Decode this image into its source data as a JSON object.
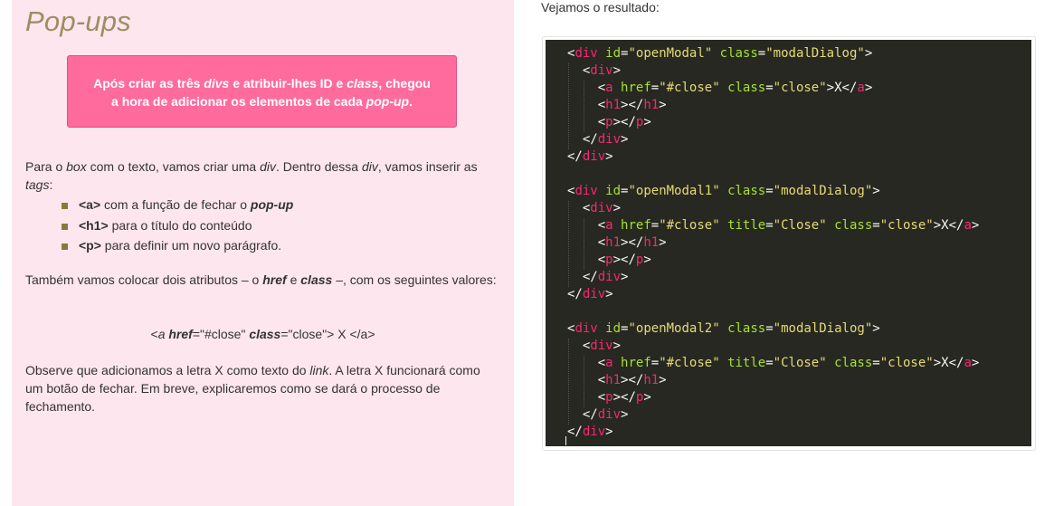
{
  "title": "Pop-ups",
  "callout": {
    "t1": "Após criar as três ",
    "e1": "divs",
    "t2": " e atribuir-lhes ID e ",
    "e2": "class",
    "t3": ", chegou a hora de adicionar os elementos de cada ",
    "e3": "pop-up",
    "t4": "."
  },
  "para1": {
    "t1": "Para o ",
    "e1": "box",
    "t2": " com o texto, vamos criar uma ",
    "e2": "div",
    "t3": ". Dentro dessa ",
    "e3": "div",
    "t4": ", vamos inserir as ",
    "e4": "tags",
    "t5": ":"
  },
  "tags": [
    {
      "tag": "<a>",
      "text": " com a função de fechar o ",
      "em": "pop-up"
    },
    {
      "tag": "<h1>",
      "text": " para o título do conteúdo",
      "em": ""
    },
    {
      "tag": "<p>",
      "text": " para definir um novo parágrafo.",
      "em": ""
    }
  ],
  "para2": {
    "t1": "Também vamos colocar dois atributos – o ",
    "e1": "href",
    "t2": " e ",
    "e2": "class",
    "t3": " –, com os seguintes valores:"
  },
  "code_example": {
    "p1": "<",
    "a": "a",
    "sp": " ",
    "href": "href",
    "v1": "=\"#close\" ",
    "cls": "class",
    "v2": "=\"close\"> ",
    "x": "X",
    "end": " </a>"
  },
  "para3": {
    "t1": "Observe que adicionamos a letra ",
    "x1": "X",
    "t2": " como texto do ",
    "e1": "link",
    "t3": ". A letra ",
    "x2": "X",
    "t4": " funcionará como um botão de fechar. Em breve, explicaremos como se dará o processo de fechamento."
  },
  "result_label": "Vejamos o resultado:",
  "code": {
    "blocks": [
      {
        "id": "openModal",
        "title": ""
      },
      {
        "id": "openModal1",
        "title": "Close"
      },
      {
        "id": "openModal2",
        "title": "Close"
      }
    ]
  },
  "colors": {
    "panel_bg": "#fde6ee",
    "callout_bg": "#ff6b9c",
    "title": "#a08c62",
    "code_bg": "#272822",
    "code_tag": "#f92672",
    "code_attr": "#a6e22e",
    "code_string": "#e6db74"
  }
}
